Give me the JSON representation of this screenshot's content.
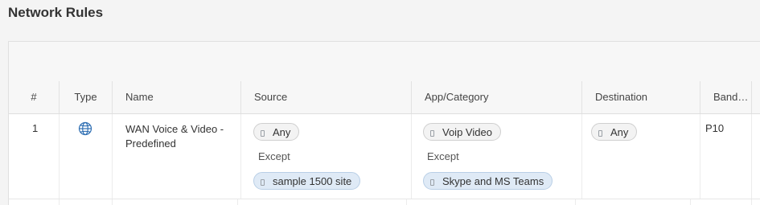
{
  "page": {
    "title": "Network Rules"
  },
  "table": {
    "columns": [
      "#",
      "Type",
      "Name",
      "Source",
      "App/Category",
      "Destination",
      "Band…"
    ],
    "rows": [
      {
        "index": "1",
        "type_icon": "globe-icon",
        "name": "WAN Voice & Video - Predefined",
        "source": {
          "include": "Any",
          "except_label": "Except",
          "exclude": "sample 1500 site"
        },
        "app": {
          "include": "Voip Video",
          "except_label": "Except",
          "exclude": "Skype and MS Teams"
        },
        "destination": "Any",
        "bandwidth": "P10"
      }
    ]
  },
  "colors": {
    "chip_blue": "#dfeaf6",
    "globe": "#2f6fb3"
  }
}
